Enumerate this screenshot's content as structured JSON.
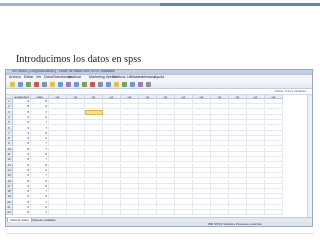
{
  "slide": {
    "title": "Introducimos los datos en spss"
  },
  "window": {
    "title": "Sin título1 [ConjuntoDatos0] - Editor de datos IBM SPSS Statistics",
    "menu": [
      "Archivo",
      "Editar",
      "Ver",
      "Datos",
      "Transformar",
      "Analizar",
      "Marketing directo",
      "Gráficos",
      "Utilidades",
      "Ventana",
      "Ayuda"
    ],
    "visible_label": "Visible: 3 de 3 variables",
    "columns": [
      "",
      "antigüedad",
      "edad",
      "var",
      "var",
      "var",
      "var",
      "var",
      "var",
      "var",
      "var",
      "var",
      "var",
      "var",
      "var",
      "var"
    ],
    "rows": [
      [
        "1",
        "9",
        "8"
      ],
      [
        "2",
        "8",
        "6"
      ],
      [
        "3",
        "8",
        "7"
      ],
      [
        "4",
        "9",
        "6"
      ],
      [
        "5",
        "8",
        "7"
      ],
      [
        "6",
        "9",
        "7"
      ],
      [
        "7",
        "9",
        "8"
      ],
      [
        "8",
        "9",
        "6"
      ],
      [
        "9",
        "8",
        "7"
      ],
      [
        "10",
        "8",
        "7"
      ],
      [
        "11",
        "9",
        "8"
      ],
      [
        "12",
        "8",
        "7"
      ],
      [
        "13",
        "9",
        "8"
      ],
      [
        "14",
        "8",
        "6"
      ],
      [
        "15",
        "9",
        "7"
      ],
      [
        "16",
        "8",
        "6"
      ],
      [
        "17",
        "9",
        "8"
      ],
      [
        "18",
        "8",
        "7"
      ],
      [
        "19",
        "9",
        "8"
      ],
      [
        "20",
        "8",
        "7"
      ],
      [
        "21",
        "9",
        "6"
      ],
      [
        "22",
        "8",
        "7"
      ]
    ],
    "tabs": [
      "Vista de datos",
      "Vista de variables"
    ],
    "status": "IBM SPSS Statistics Processor está listo"
  },
  "colors": {
    "accent": "#f6e08e",
    "slide_bar_1": "#9bb5d9",
    "slide_bar_2": "#5f84b8"
  }
}
